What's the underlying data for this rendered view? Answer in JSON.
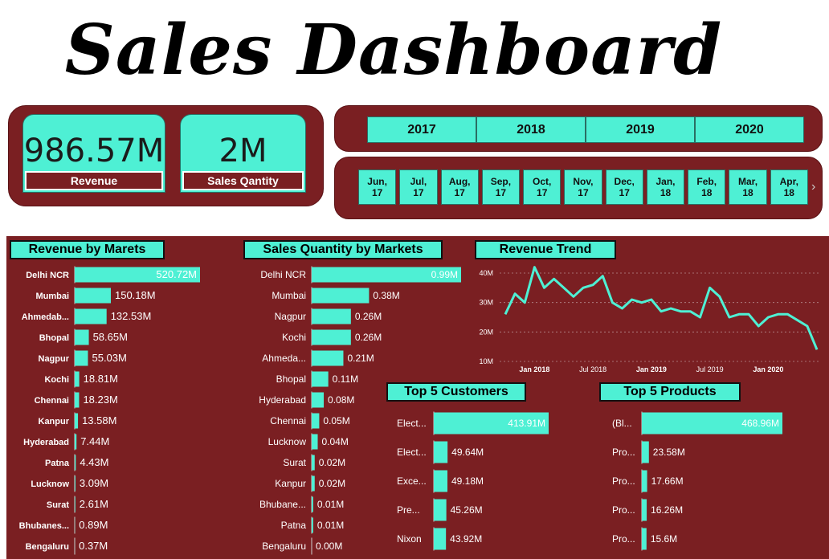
{
  "page": {
    "title": "Sales Dashboard"
  },
  "kpis": {
    "revenue": {
      "value": "986.57M",
      "label": "Revenue"
    },
    "quantity": {
      "value": "2M",
      "label": "Sales Qantity"
    }
  },
  "year_filter": [
    "2017",
    "2018",
    "2019",
    "2020"
  ],
  "month_filter": [
    [
      "Jun,",
      "17"
    ],
    [
      "Jul,",
      "17"
    ],
    [
      "Aug,",
      "17"
    ],
    [
      "Sep,",
      "17"
    ],
    [
      "Oct,",
      "17"
    ],
    [
      "Nov,",
      "17"
    ],
    [
      "Dec,",
      "17"
    ],
    [
      "Jan,",
      "18"
    ],
    [
      "Feb,",
      "18"
    ],
    [
      "Mar,",
      "18"
    ],
    [
      "Apr,",
      "18"
    ]
  ],
  "icons": {
    "scroll_right": "chevron-right-icon"
  },
  "colors": {
    "accent": "#4ef0d4",
    "panel": "#7a1f22",
    "text_light": "#ffffff"
  },
  "sections": {
    "revenue_by_markets": "Revenue by Marets",
    "quantity_by_markets": "Sales Quantity by Markets",
    "revenue_trend": "Revenue Trend",
    "top_customers": "Top 5 Customers",
    "top_products": "Top 5 Products"
  },
  "chart_data": [
    {
      "id": "revenue_by_markets",
      "type": "bar",
      "orientation": "horizontal",
      "title": "Revenue by Marets",
      "categories": [
        "Delhi NCR",
        "Mumbai",
        "Ahmedab...",
        "Bhopal",
        "Nagpur",
        "Kochi",
        "Chennai",
        "Kanpur",
        "Hyderabad",
        "Patna",
        "Lucknow",
        "Surat",
        "Bhubanes...",
        "Bengaluru"
      ],
      "values": [
        520.72,
        150.18,
        132.53,
        58.65,
        55.03,
        18.81,
        18.23,
        13.58,
        7.44,
        4.43,
        3.09,
        2.61,
        0.89,
        0.37
      ],
      "labels": [
        "520.72M",
        "150.18M",
        "132.53M",
        "58.65M",
        "55.03M",
        "18.81M",
        "18.23M",
        "13.58M",
        "7.44M",
        "4.43M",
        "3.09M",
        "2.61M",
        "0.89M",
        "0.37M"
      ]
    },
    {
      "id": "quantity_by_markets",
      "type": "bar",
      "orientation": "horizontal",
      "title": "Sales Quantity by Markets",
      "categories": [
        "Delhi NCR",
        "Mumbai",
        "Nagpur",
        "Kochi",
        "Ahmeda...",
        "Bhopal",
        "Hyderabad",
        "Chennai",
        "Lucknow",
        "Surat",
        "Kanpur",
        "Bhubane...",
        "Patna",
        "Bengaluru"
      ],
      "values": [
        0.99,
        0.38,
        0.26,
        0.26,
        0.21,
        0.11,
        0.08,
        0.05,
        0.04,
        0.02,
        0.02,
        0.01,
        0.01,
        0.0
      ],
      "labels": [
        "0.99M",
        "0.38M",
        "0.26M",
        "0.26M",
        "0.21M",
        "0.11M",
        "0.08M",
        "0.05M",
        "0.04M",
        "0.02M",
        "0.02M",
        "0.01M",
        "0.01M",
        "0.00M"
      ]
    },
    {
      "id": "revenue_trend",
      "type": "line",
      "title": "Revenue Trend",
      "x": [
        "2017-10",
        "2017-11",
        "2017-12",
        "2018-01",
        "2018-02",
        "2018-03",
        "2018-04",
        "2018-05",
        "2018-06",
        "2018-07",
        "2018-08",
        "2018-09",
        "2018-10",
        "2018-11",
        "2018-12",
        "2019-01",
        "2019-02",
        "2019-03",
        "2019-04",
        "2019-05",
        "2019-06",
        "2019-07",
        "2019-08",
        "2019-09",
        "2019-10",
        "2019-11",
        "2019-12",
        "2020-01",
        "2020-02",
        "2020-03",
        "2020-04",
        "2020-05",
        "2020-06"
      ],
      "values": [
        26,
        33,
        30,
        42,
        35,
        38,
        35,
        32,
        35,
        36,
        39,
        30,
        28,
        31,
        30,
        31,
        27,
        28,
        27,
        27,
        25,
        35,
        32,
        25,
        26,
        26,
        22,
        25,
        26,
        26,
        24,
        22,
        14
      ],
      "x_ticks": [
        "Jan 2018",
        "Jul 2018",
        "Jan 2019",
        "Jul 2019",
        "Jan 2020"
      ],
      "y_ticks": [
        "10M",
        "20M",
        "30M",
        "40M"
      ],
      "ylim": [
        10,
        45
      ],
      "grid": true
    },
    {
      "id": "top_customers",
      "type": "bar",
      "orientation": "horizontal",
      "title": "Top 5 Customers",
      "categories": [
        "Elect...",
        "Elect...",
        "Exce...",
        "Pre...",
        "Nixon"
      ],
      "values": [
        413.91,
        49.64,
        49.18,
        45.26,
        43.92
      ],
      "labels": [
        "413.91M",
        "49.64M",
        "49.18M",
        "45.26M",
        "43.92M"
      ]
    },
    {
      "id": "top_products",
      "type": "bar",
      "orientation": "horizontal",
      "title": "Top 5 Products",
      "categories": [
        "(Bl...",
        "Pro...",
        "Pro...",
        "Pro...",
        "Pro..."
      ],
      "values": [
        468.96,
        23.58,
        17.66,
        16.26,
        15.6
      ],
      "labels": [
        "468.96M",
        "23.58M",
        "17.66M",
        "16.26M",
        "15.6M"
      ]
    }
  ]
}
